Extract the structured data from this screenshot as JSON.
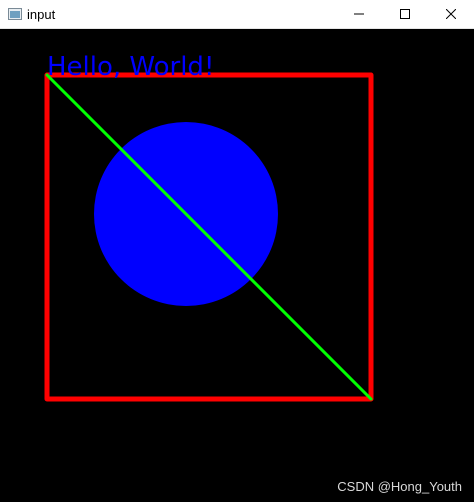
{
  "window": {
    "title": "input",
    "buttons": {
      "minimize_icon": "minimize-icon",
      "maximize_icon": "maximize-icon",
      "close_icon": "close-icon"
    }
  },
  "canvas": {
    "background": "#000000",
    "text": {
      "value": "Hello, World!",
      "color": "#0000ff"
    },
    "rectangle": {
      "color": "#ff0000"
    },
    "circle": {
      "color": "#0000ff"
    },
    "line": {
      "color": "#00ff00"
    }
  },
  "watermark": "CSDN @Hong_Youth"
}
